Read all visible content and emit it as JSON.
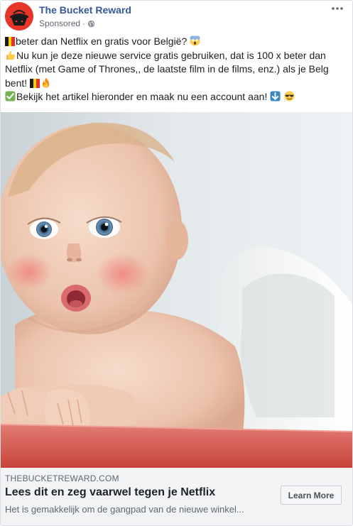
{
  "header": {
    "page_name": "The Bucket Reward",
    "sponsored": "Sponsored",
    "separator": "·",
    "avatar_icon": "bucket-logo-icon",
    "privacy_icon": "globe-icon",
    "more_icon": "more-options-icon"
  },
  "post_text": {
    "line1": "beter dan Netflix en gratis voor België?",
    "line2": "Nu kun je deze nieuwe service gratis gebruiken, dat is 100 x beter dan Netflix (met Game of Thrones,, de laatste film in de films, enz.) als je Belg bent!",
    "line3": "Bekijk het artikel hieronder en maak nu een account aan!",
    "emojis": [
      "belgian-flag",
      "screaming-face",
      "thumbs-up",
      "belgian-flag",
      "fire",
      "check-mark",
      "down-arrow",
      "sunglasses-face"
    ]
  },
  "media": {
    "subject": "surprised-baby-photo"
  },
  "link": {
    "domain": "THEBUCKETREWARD.COM",
    "title": "Lees dit en zeg vaarwel tegen je Netflix",
    "description": "Het is gemakkelijk om de gangpad van de nieuwe winkel...",
    "cta_label": "Learn More"
  },
  "colors": {
    "page_name": "#365899",
    "avatar_bg": "#e8352a",
    "footer_bg": "#f2f3f5",
    "text": "#1c1e21",
    "meta": "#616770"
  }
}
